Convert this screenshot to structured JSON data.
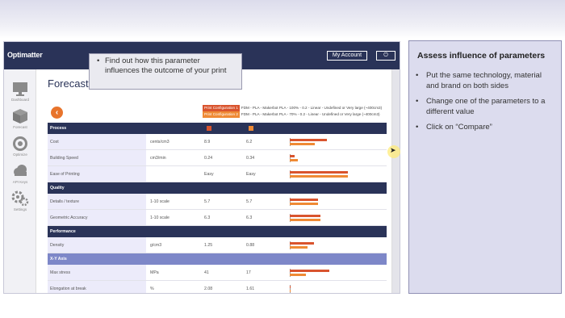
{
  "app": {
    "logo": "Optimatter",
    "account_label": "My Account",
    "power_label": "⏻",
    "page_title": "Forecast"
  },
  "sidebar": {
    "items": [
      {
        "label": "Dashboard",
        "icon": "monitor-icon"
      },
      {
        "label": "Forecast",
        "icon": "cube-icon"
      },
      {
        "label": "Optimize",
        "icon": "target-icon"
      },
      {
        "label": "API Keys",
        "icon": "cloud-icon"
      },
      {
        "label": "Settings",
        "icon": "gears-icon"
      }
    ]
  },
  "configs": [
    {
      "badge": "Print Configuration 1",
      "text": "FDM - PLA - Makerbot PLA - 100% - 0.2 - Linear - Undefined or Very large (~400cm3)",
      "color": "#d9542e"
    },
    {
      "badge": "Print Configuration 2",
      "text": "FDM - PLA - Makerbot PLA - 70% - 0.2 - Linear - Undefined or Very large (~400cm3)",
      "color": "#ef8a35"
    }
  ],
  "table": {
    "sections": [
      {
        "title": "Process",
        "style": "dark",
        "rows": [
          {
            "name": "Cost",
            "unit": "cents/cm3",
            "v1": "8.9",
            "v2": "6.2",
            "bar1": 0.38,
            "bar2": 0.26
          },
          {
            "name": "Building Speed",
            "unit": "cm3/min",
            "v1": "0.24",
            "v2": "0.34",
            "bar1": 0.05,
            "bar2": 0.08
          },
          {
            "name": "Ease of Printing",
            "unit": "",
            "v1": "Easy",
            "v2": "Easy",
            "bar1": 0.6,
            "bar2": 0.6
          }
        ]
      },
      {
        "title": "Quality",
        "style": "dark",
        "rows": [
          {
            "name": "Details / texture",
            "unit": "1-10 scale",
            "v1": "5.7",
            "v2": "5.7",
            "bar1": 0.29,
            "bar2": 0.29
          },
          {
            "name": "Geometric Accuracy",
            "unit": "1-10 scale",
            "v1": "6.3",
            "v2": "6.3",
            "bar1": 0.32,
            "bar2": 0.32
          }
        ]
      },
      {
        "title": "Performance",
        "style": "dark",
        "rows": [
          {
            "name": "Density",
            "unit": "g/cm3",
            "v1": "1.25",
            "v2": "0.88",
            "bar1": 0.25,
            "bar2": 0.18
          }
        ]
      },
      {
        "title": "X-Y Axis",
        "style": "light",
        "rows": [
          {
            "name": "Max stress",
            "unit": "MPa",
            "v1": "41",
            "v2": "17",
            "bar1": 0.41,
            "bar2": 0.17
          },
          {
            "name": "Elongation at break",
            "unit": "%",
            "v1": "2.08",
            "v2": "1.61",
            "bar1": 0.01,
            "bar2": 0.01
          }
        ]
      }
    ]
  },
  "tooltip": {
    "text": "Find out how this parameter influences the outcome of your print"
  },
  "panel": {
    "title": "Assess influence of parameters",
    "bullets": [
      "Put the same technology, material and brand on both sides",
      "Change one of the parameters to a different value",
      "Click on “Compare”"
    ]
  }
}
